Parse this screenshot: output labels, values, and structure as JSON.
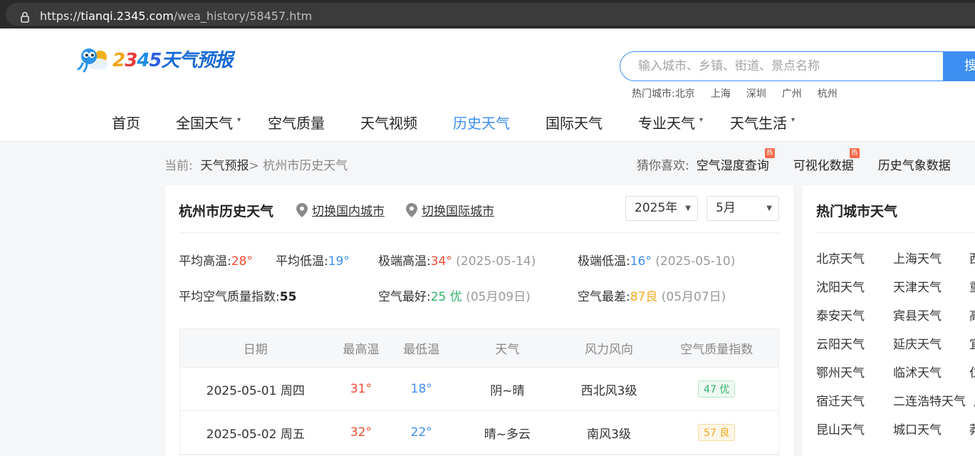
{
  "browser": {
    "url_scheme": "https://",
    "url_host": "tianqi.2345.com",
    "url_path": "/wea_history/58457.htm"
  },
  "logo": {
    "digit2": "2",
    "digit3": "3",
    "digit4": "4",
    "digit5": "5",
    "text": "天气预报"
  },
  "search": {
    "placeholder": "输入城市、乡镇、街道、景点名称",
    "button_label": "搜索"
  },
  "hot_cities": {
    "label": "热门城市:",
    "items": [
      "北京",
      "上海",
      "深圳",
      "广州",
      "杭州"
    ]
  },
  "nav": {
    "items": [
      {
        "label": "首页",
        "has_caret": false
      },
      {
        "label": "全国天气",
        "has_caret": true
      },
      {
        "label": "空气质量",
        "has_caret": false
      },
      {
        "label": "天气视频",
        "has_caret": false
      },
      {
        "label": "历史天气",
        "has_caret": false,
        "active": true
      },
      {
        "label": "国际天气",
        "has_caret": false
      },
      {
        "label": "专业天气",
        "has_caret": true
      },
      {
        "label": "天气生活",
        "has_caret": true
      }
    ],
    "caret": "▾"
  },
  "breadcrumb": {
    "prefix": "当前:",
    "home": "天气预报",
    "sep": ">",
    "current": "杭州市历史天气"
  },
  "guess": {
    "label": "猜你喜欢:",
    "items": [
      {
        "label": "空气湿度查询",
        "hot": "热"
      },
      {
        "label": "可视化数据",
        "hot": "热"
      },
      {
        "label": "历史气象数据",
        "hot": ""
      }
    ]
  },
  "main": {
    "title": "杭州市历史天气",
    "switch_domestic": "切换国内城市",
    "switch_international": "切换国际城市",
    "year_select": "2025年",
    "month_select": "5月",
    "stats": {
      "avg_high_label": "平均高温:",
      "avg_high": "28°",
      "avg_low_label": "平均低温:",
      "avg_low": "19°",
      "max_high_label": "极端高温:",
      "max_high": "34°",
      "max_high_date": "(2025-05-14)",
      "min_low_label": "极端低温:",
      "min_low": "16°",
      "min_low_date": "(2025-05-10)",
      "avg_aqi_label": "平均空气质量指数:",
      "avg_aqi": "55",
      "best_air_label": "空气最好:",
      "best_air": "25 优",
      "best_air_date": "(05月09日)",
      "worst_air_label": "空气最差:",
      "worst_air": "87良",
      "worst_air_date": "(05月07日)"
    },
    "table": {
      "headers": [
        "日期",
        "最高温",
        "最低温",
        "天气",
        "风力风向",
        "空气质量指数"
      ],
      "rows": [
        {
          "date": "2025-05-01 周四",
          "high": "31°",
          "low": "18°",
          "weather": "阴~晴",
          "wind": "西北风3级",
          "aqi": "47 优",
          "aqi_level": "good"
        },
        {
          "date": "2025-05-02 周五",
          "high": "32°",
          "low": "22°",
          "weather": "晴~多云",
          "wind": "南风3级",
          "aqi": "57 良",
          "aqi_level": "fair"
        }
      ]
    }
  },
  "sidebar": {
    "title": "热门城市天气",
    "rows": [
      [
        "北京天气",
        "上海天气",
        "西"
      ],
      [
        "沈阳天气",
        "天津天气",
        "重"
      ],
      [
        "泰安天气",
        "宾县天气",
        "高"
      ],
      [
        "云阳天气",
        "延庆天气",
        "宜"
      ],
      [
        "鄂州天气",
        "临沭天气",
        "仁"
      ],
      [
        "宿迁天气",
        "二连浩特天气",
        "广"
      ],
      [
        "昆山天气",
        "城口天气",
        "莽"
      ]
    ]
  },
  "colors": {
    "accent_blue": "#3d8ef0",
    "temp_red": "#ef4b2f",
    "aqi_good": "#2fb36a",
    "aqi_fair": "#f2a81d"
  }
}
